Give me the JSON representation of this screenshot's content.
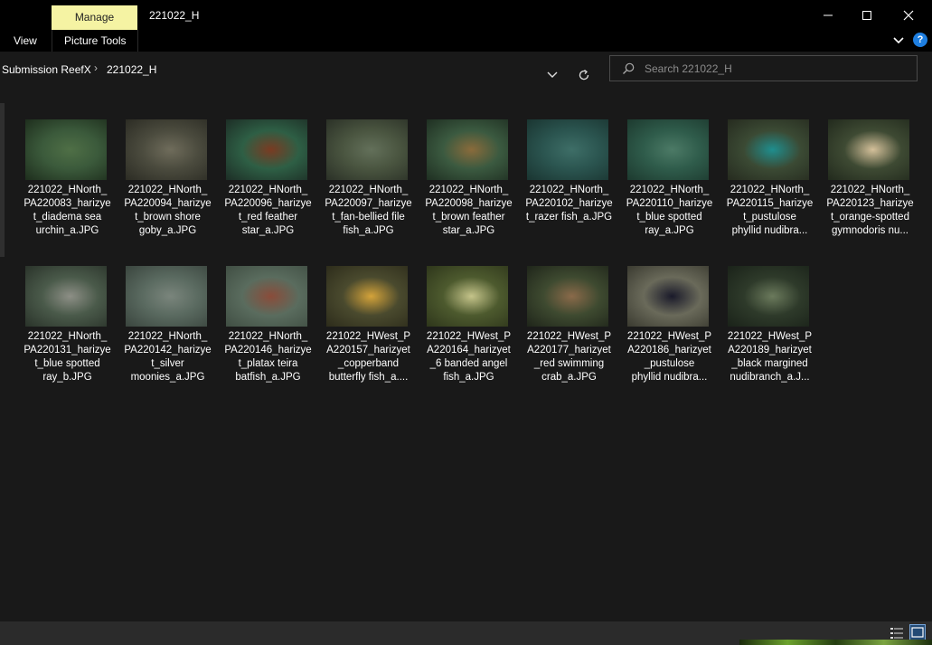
{
  "titlebar": {
    "manage_label": "Manage",
    "window_title": "221022_H",
    "minimize_label": "—",
    "maximize_label": "☐",
    "close_label": "✕"
  },
  "ribbon": {
    "view_label": "View",
    "picture_tools_label": "Picture Tools",
    "help_label": "?"
  },
  "address": {
    "crumbs": [
      "Submission ReefX",
      "221022_H"
    ],
    "separator": "›"
  },
  "search": {
    "placeholder": "Search 221022_H"
  },
  "colors": {
    "manage_tab": "#f5f3a3",
    "background": "#191919",
    "titlebar": "#000000",
    "accent": "#1e7ee0"
  },
  "files": [
    {
      "lines": [
        "221022_HNorth_",
        "PA220083_harizye",
        "t_diadema sea",
        "urchin_a.JPG"
      ],
      "thumb": [
        "#3b5a3b",
        "#1e2e1d",
        "#4f6f46"
      ]
    },
    {
      "lines": [
        "221022_HNorth_",
        "PA220094_harizye",
        "t_brown shore",
        "goby_a.JPG"
      ],
      "thumb": [
        "#4b4b3e",
        "#2c2c24",
        "#6f6c5b"
      ]
    },
    {
      "lines": [
        "221022_HNorth_",
        "PA220096_harizye",
        "t_red feather",
        "star_a.JPG"
      ],
      "thumb": [
        "#2e5f45",
        "#1d2e26",
        "#7a3b22"
      ]
    },
    {
      "lines": [
        "221022_HNorth_",
        "PA220097_harizye",
        "t_fan-bellied file",
        "fish_a.JPG"
      ],
      "thumb": [
        "#4a5540",
        "#2b3127",
        "#63705a"
      ]
    },
    {
      "lines": [
        "221022_HNorth_",
        "PA220098_harizye",
        "t_brown feather",
        "star_a.JPG"
      ],
      "thumb": [
        "#3b5a40",
        "#1f2f22",
        "#8a6b3b"
      ]
    },
    {
      "lines": [
        "221022_HNorth_",
        "PA220102_harizye",
        "t_razer fish_a.JPG"
      ],
      "thumb": [
        "#2b5550",
        "#1a3531",
        "#3e6e67"
      ]
    },
    {
      "lines": [
        "221022_HNorth_",
        "PA220110_harizye",
        "t_blue spotted",
        "ray_a.JPG"
      ],
      "thumb": [
        "#2f5c4b",
        "#1d3a2f",
        "#4c7a66"
      ]
    },
    {
      "lines": [
        "221022_HNorth_",
        "PA220115_harizye",
        "t_pustulose",
        "phyllid nudibra..."
      ],
      "thumb": [
        "#3b4a34",
        "#262b1f",
        "#1f8e8e"
      ]
    },
    {
      "lines": [
        "221022_HNorth_",
        "PA220123_harizye",
        "t_orange-spotted",
        "gymnodoris nu..."
      ],
      "thumb": [
        "#3e4a33",
        "#222a1d",
        "#d4c09a"
      ]
    },
    {
      "lines": [
        "221022_HNorth_",
        "PA220131_harizye",
        "t_blue spotted",
        "ray_b.JPG"
      ],
      "thumb": [
        "#4a5a4a",
        "#2a332a",
        "#8d8f86"
      ]
    },
    {
      "lines": [
        "221022_HNorth_",
        "PA220142_harizye",
        "t_silver",
        "moonies_a.JPG"
      ],
      "thumb": [
        "#5a6a60",
        "#3a453e",
        "#7a857c"
      ]
    },
    {
      "lines": [
        "221022_HNorth_",
        "PA220146_harizye",
        "t_platax teira",
        "batfish_a.JPG"
      ],
      "thumb": [
        "#5a6c5e",
        "#404e43",
        "#8a4c3a"
      ]
    },
    {
      "lines": [
        "221022_HWest_P",
        "A220157_harizyet",
        "_copperband",
        "butterfly fish_a...."
      ],
      "thumb": [
        "#4a4a2e",
        "#2d2c1b",
        "#d4a33a"
      ]
    },
    {
      "lines": [
        "221022_HWest_P",
        "A220164_harizyet",
        "_6 banded angel",
        "fish_a.JPG"
      ],
      "thumb": [
        "#4d5a2e",
        "#2e361b",
        "#c5c48a"
      ]
    },
    {
      "lines": [
        "221022_HWest_P",
        "A220177_harizyet",
        "_red swimming",
        "crab_a.JPG"
      ],
      "thumb": [
        "#3e4a30",
        "#1f251a",
        "#8a6a4a"
      ]
    },
    {
      "lines": [
        "221022_HWest_P",
        "A220186_harizyet",
        "_pustulose",
        "phyllid nudibra..."
      ],
      "thumb": [
        "#6a6a5a",
        "#3a3a30",
        "#1a1a2a"
      ]
    },
    {
      "lines": [
        "221022_HWest_P",
        "A220189_harizyet",
        "_black margined",
        "nudibranch_a.J..."
      ],
      "thumb": [
        "#2e3a2a",
        "#1a2219",
        "#6b7a5c"
      ]
    }
  ]
}
